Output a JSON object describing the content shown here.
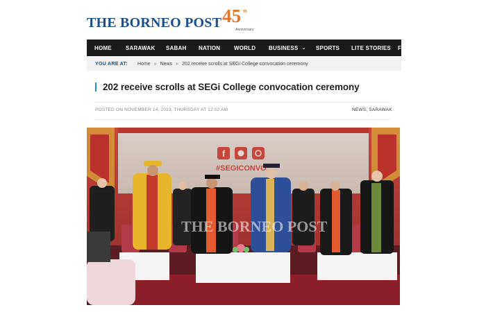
{
  "logo": {
    "text": "THE BORNEO POST",
    "number": "45",
    "suffix": "th",
    "subtitle": "Anniversary"
  },
  "nav": {
    "items": [
      {
        "label": "HOME"
      },
      {
        "label": "SARAWAK"
      },
      {
        "label": "SABAH"
      },
      {
        "label": "NATION"
      },
      {
        "label": "WORLD"
      },
      {
        "label": "BUSINESS",
        "has_dropdown": true
      },
      {
        "label": "SPORTS"
      },
      {
        "label": "LITE STORIES"
      },
      {
        "label": "F"
      }
    ]
  },
  "breadcrumb": {
    "lead": "YOU ARE AT:",
    "items": [
      "Home",
      "News",
      "202 receive scrolls at SEGi College convocation ceremony"
    ],
    "separator": "»"
  },
  "article": {
    "title": "202 receive scrolls at SEGi College convocation ceremony",
    "posted_on": "POSTED ON NOVEMBER 14, 2019, THURSDAY AT 12:02 AM",
    "categories": "NEWS, SARAWAK"
  },
  "photo": {
    "hashtag": "#SEGICONVO",
    "watermark": "THE BORNEO POST",
    "social_icons": [
      "facebook-icon",
      "twitter-icon",
      "instagram-icon"
    ]
  },
  "colors": {
    "brand_blue": "#1a4f8b",
    "accent_orange": "#e0752d",
    "nav_bg": "#1b1b1b",
    "title_accent": "#1a90d0"
  }
}
